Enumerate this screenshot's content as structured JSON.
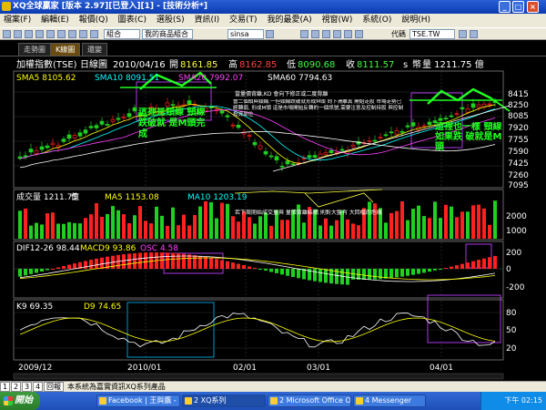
{
  "window": {
    "title": "XQ全球贏家 [版本 2.97][已登入][1] - [技術分析*]",
    "min_glyph": "_",
    "max_glyph": "□",
    "close_glyph": "×"
  },
  "menu": [
    "檔案(F)",
    "編輯(E)",
    "報價(Q)",
    "圖表(C)",
    "選股(S)",
    "資訊(I)",
    "交易(T)",
    "我的最愛(A)",
    "視窗(W)",
    "系統(O)",
    "說明(H)"
  ],
  "toolbar": {
    "group_value": "組合",
    "favorites_value": "我的商品組合",
    "search_value": "sinsa",
    "mode_label": "代碼",
    "symbol_value": "TSE.TW"
  },
  "tabs": [
    "走勢圖",
    "K線圖",
    "還變"
  ],
  "chart": {
    "header": {
      "name": "加權指數(TSE)",
      "period": "日線圖",
      "date": "2010/04/16",
      "open_label": "開",
      "open": "8161.85",
      "high_label": "高",
      "high": "8162.85",
      "low_label": "低",
      "low": "8090.68",
      "close_label": "收",
      "close": "8111.57",
      "s_label": "s",
      "volume_label": "幣",
      "volume_text": "量 1211.75 億"
    },
    "ma": {
      "sma5": "SMA5 8105.62",
      "sma10": "SMA10 8091.51",
      "sma20": "SMA20 7992.07",
      "sma60": "SMA60 7794.63"
    },
    "annotations": {
      "top_note": "當量價背離,KD 會向下修正或二度背離",
      "main_note": "當二個頭與頸線,一但頸線跌破就形成M頭 向下滑離真 開始走股 市場走勢已經轉弱, 形成M頭 這是市場開始反轉的一個訊號,需要注意及控制持股 與控制投資部位",
      "left_note": "這裡是頸線 頸線跌破就 是M頭完成",
      "right_note": "這裡也一樣 頸線如果跌 破就是M頭",
      "volume_note": "若下周開始成交量與 量價背離結構 則對大盤有 大回檔的危機"
    },
    "volume": {
      "label": "成交量 1211.75",
      "unit": "億",
      "ma5": "MA5 1153.08",
      "ma10": "MA10 1203.19"
    },
    "macd": {
      "dif": "DIF12-26 98.44",
      "macd": "MACD9 93.86",
      "osc": "OSC 4.58"
    },
    "kd": {
      "k": "K9 69.35",
      "d": "D9 74.65"
    },
    "price_axis": [
      "8415",
      "8250",
      "8085",
      "7920",
      "7755",
      "7590",
      "7425",
      "7260",
      "7095"
    ],
    "volume_axis": [
      "2000",
      "1000"
    ],
    "macd_axis": [
      "200",
      "0",
      "-200"
    ],
    "kd_axis": [
      "80",
      "50",
      "20"
    ],
    "date_axis": [
      "2009/12",
      "2010/01",
      "02/01",
      "03/01",
      "04/01"
    ],
    "colors": {
      "up": "#ff2020",
      "down": "#20d020",
      "sma5": "#ffff00",
      "sma10": "#00ffff",
      "sma20": "#ff40ff",
      "sma60": "#ffffff",
      "annotation": "#20ff20",
      "box": "#c040ff"
    }
  },
  "status": {
    "pages": [
      "1",
      "2",
      "3",
      "4",
      "回報"
    ],
    "text": "本系統為嘉實資訊XQ系列產品"
  },
  "taskbar": {
    "start_label": "開始",
    "tasks": [
      "Facebook | 王與鷹 -",
      "2 XQ系列",
      "2 Microsoft Office O...",
      "4 Messenger"
    ],
    "clock": "下午 02:15"
  }
}
